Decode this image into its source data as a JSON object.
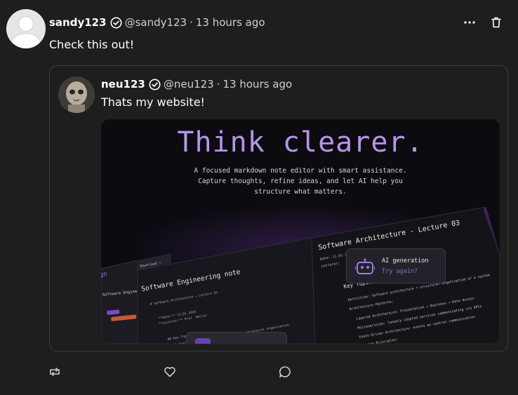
{
  "post": {
    "author": {
      "display_name": "sandy123",
      "handle": "@sandy123",
      "separator": "·",
      "time": "13 hours ago"
    },
    "text": "Check this out!",
    "icons": {
      "verified": "verified-badge-icon",
      "more": "more-dots-icon",
      "delete": "trash-icon"
    }
  },
  "quoted_post": {
    "author": {
      "display_name": "neu123",
      "handle": "@neu123",
      "separator": "·",
      "time": "13 hours ago"
    },
    "text": "Thats my website!",
    "preview": {
      "headline": "Think clearer.",
      "subline_1": "A focused markdown note editor with smart assistance.",
      "subline_2": "Capture thoughts, refine ideas, and let AI help you",
      "subline_3": "structure what matters.",
      "left_panel_title": "Software Engineering note",
      "right_panel_title": "Software Architecture - Lecture 03",
      "sidebar_note": "Software Engineering note",
      "right_section": "Key Topics",
      "right_items": [
        "Definition: Software architecture = structural organization of a system",
        "Architecture Patterns:",
        "Layered Architecture: Presentation → Business → Data Access",
        "Microservices: loosely coupled services communicating via APIs",
        "Event-Driven Architecture: events as central communication",
        "Design Principles:"
      ],
      "ai_card_title": "AI generation",
      "ai_card_action": "Try again?"
    }
  },
  "actions": {
    "repost": "repost-icon",
    "like": "heart-icon",
    "comment": "comment-icon"
  },
  "colors": {
    "background": "#1e1e1e",
    "border": "#3d3d3d",
    "muted_text": "#d0d0d0",
    "accent_purple": "#b794ec"
  }
}
